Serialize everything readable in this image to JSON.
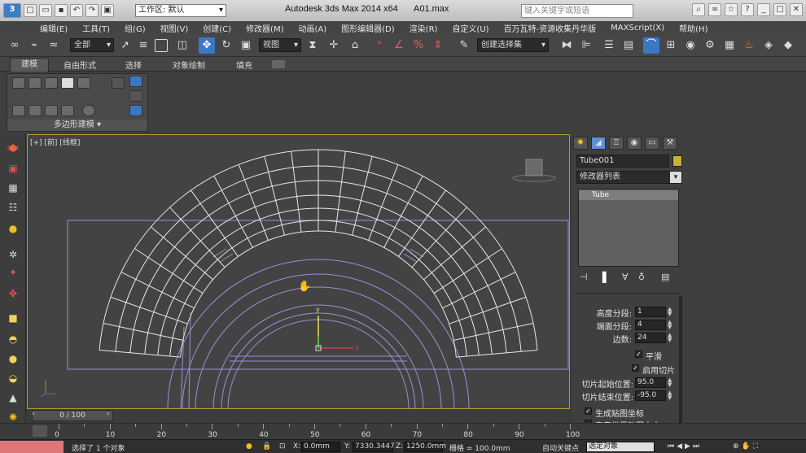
{
  "app": {
    "title": "Autodesk 3ds Max  2014 x64",
    "file": "A01.max",
    "workspace": "工作区: 默认",
    "search_placeholder": "键入关键字或短语"
  },
  "menu": [
    "编辑(E)",
    "工具(T)",
    "组(G)",
    "视图(V)",
    "创建(C)",
    "修改器(M)",
    "动画(A)",
    "图形编辑器(D)",
    "渲染(R)",
    "自定义(U)",
    "百万瓦特-资源收集丹华版",
    "MAXScript(X)",
    "帮助(H)"
  ],
  "toolbar": {
    "selection_filter": "全部",
    "ref_coord": "视图",
    "named_selection": "创建选择集"
  },
  "ribbon": {
    "tabs": [
      "建模",
      "自由形式",
      "选择",
      "对象绘制",
      "填充"
    ],
    "panel_label": "多边形建模"
  },
  "viewport": {
    "label": "[+] [前] [线框]",
    "axis_y": "y",
    "axis_x": "x"
  },
  "command_panel": {
    "object_name": "Tube001",
    "modifier_list": "修改器列表",
    "stack_item": "Tube",
    "params": [
      {
        "label": "高度分段:",
        "value": "1"
      },
      {
        "label": "端面分段:",
        "value": "4"
      },
      {
        "label": "边数:",
        "value": "24"
      }
    ],
    "smooth_label": "平滑",
    "slice_on_label": "启用切片",
    "slice_from_label": "切片起始位置:",
    "slice_from_value": "95.0",
    "slice_to_label": "切片结束位置:",
    "slice_to_value": "-95.0",
    "gen_mapping_label": "生成贴图坐标",
    "real_world_label": "真实世界贴图大小"
  },
  "timeline": {
    "frame": "0 / 100",
    "ticks": [
      "0",
      "10",
      "20",
      "30",
      "40",
      "50",
      "60",
      "70",
      "80",
      "90",
      "100"
    ]
  },
  "status": {
    "selected": "选择了 1 个对象",
    "x_label": "X:",
    "x_value": "0.0mm",
    "y_label": "Y:",
    "y_value": "7330.3447",
    "z_label": "Z:",
    "z_value": "1250.0mm",
    "grid": "栅格 = 100.0mm",
    "autokey": "自动关键点",
    "key_filter": "选定对象"
  },
  "colors": {
    "viewport_border": "#b89a30",
    "wire_white": "#e8e8e8",
    "wire_purple": "#9c8fd6"
  }
}
